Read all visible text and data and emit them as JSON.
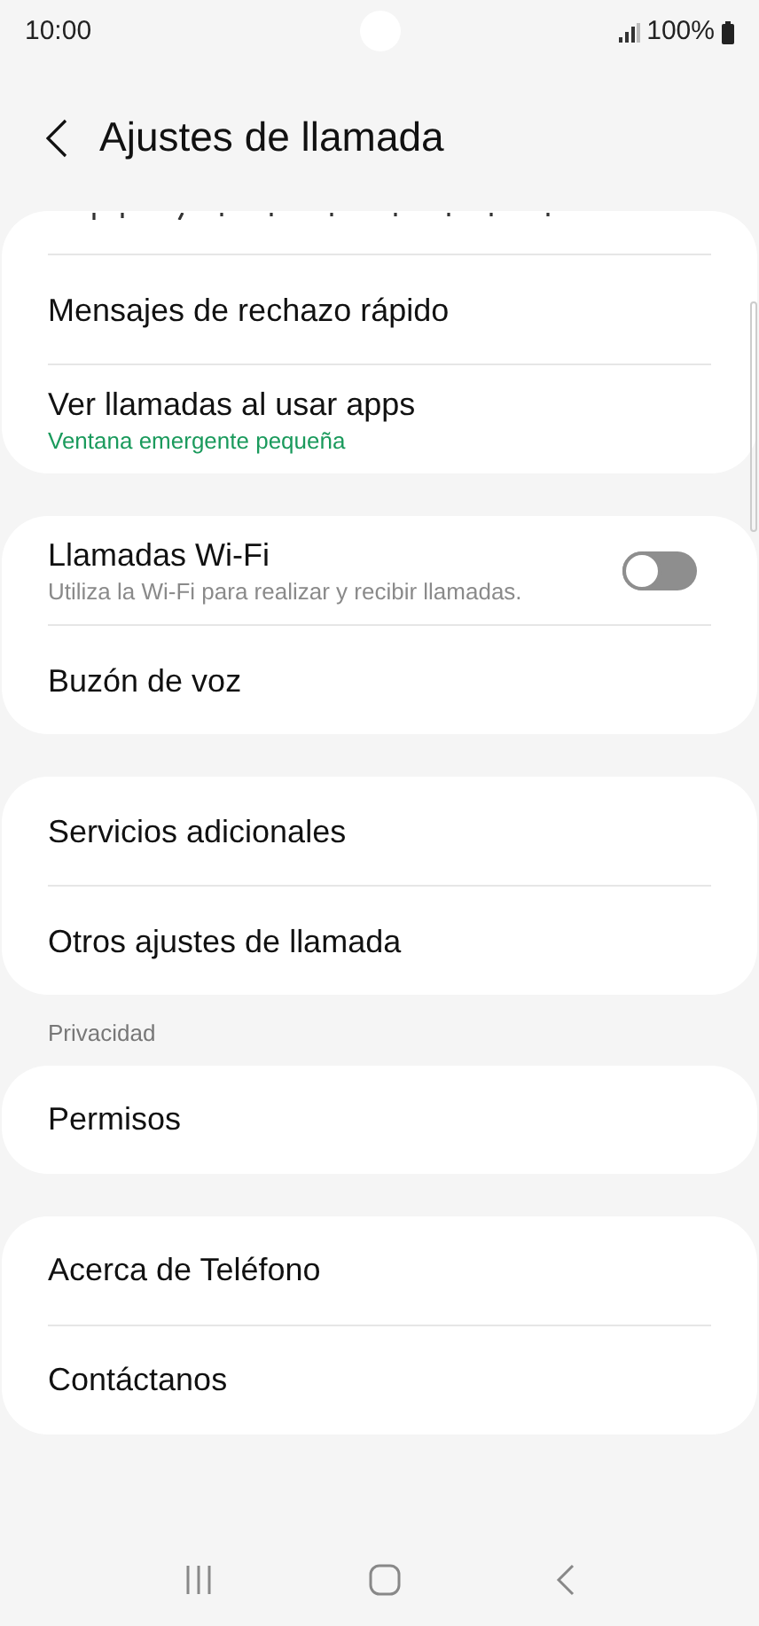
{
  "status_bar": {
    "time": "10:00",
    "battery": "100%"
  },
  "header": {
    "title": "Ajustes de llamada"
  },
  "sections": [
    {
      "clipped_top": true,
      "items": [
        {
          "kind": "link",
          "title": "Mensajes de rechazo rápido"
        },
        {
          "kind": "value",
          "title": "Ver llamadas al usar apps",
          "subtitle": "Ventana emergente pequeña"
        }
      ]
    },
    {
      "items": [
        {
          "kind": "switch",
          "title": "Llamadas Wi-Fi",
          "subtitle": "Utiliza la Wi-Fi para realizar y recibir llamadas.",
          "on": false
        },
        {
          "kind": "link",
          "title": "Buzón de voz"
        }
      ]
    },
    {
      "items": [
        {
          "kind": "link",
          "title": "Servicios adicionales"
        },
        {
          "kind": "link",
          "title": "Otros ajustes de llamada"
        }
      ]
    },
    {
      "header": "Privacidad",
      "items": [
        {
          "kind": "link",
          "title": "Permisos"
        }
      ]
    },
    {
      "items": [
        {
          "kind": "link",
          "title": "Acerca de Teléfono"
        },
        {
          "kind": "link",
          "title": "Contáctanos"
        }
      ]
    }
  ]
}
